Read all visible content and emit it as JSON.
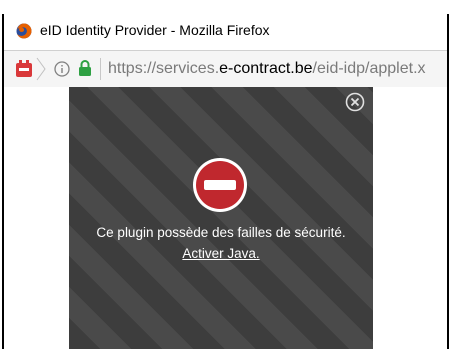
{
  "top_strip": {
    "text": ""
  },
  "window": {
    "title": "eID Identity Provider - Mozilla Firefox"
  },
  "urlbar": {
    "url_prefix": "https://services.",
    "url_domain": "e-contract.be",
    "url_suffix": "/eid-idp/applet.x"
  },
  "plugin": {
    "message": "Ce plugin possède des failles de sécurité.",
    "activate_link": "Activer Java."
  },
  "icons": {
    "browser": "firefox-icon",
    "plugin": "plugin-blocked-icon",
    "info": "info-icon",
    "lock": "lock-icon",
    "close": "close-icon",
    "blocked": "blocked-icon"
  },
  "colors": {
    "plugin_background_dark": "#3d3d3d",
    "plugin_background_light": "#4a4a4a",
    "blocked_red": "#c0282e",
    "lock_green": "#2ea043"
  }
}
